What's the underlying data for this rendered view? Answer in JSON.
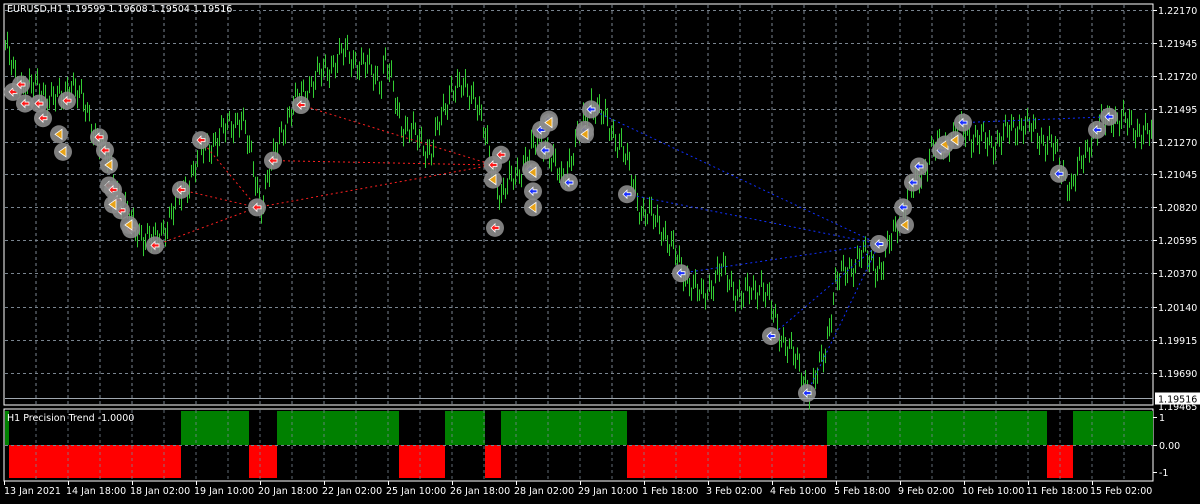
{
  "chart_data": {
    "type": "candlestick-bars",
    "symbol": "EURUSD",
    "timeframe": "H1",
    "title": "EURUSD,H1",
    "ohlc_last": {
      "open": "1.19599",
      "high": "1.19608",
      "low": "1.19504",
      "close": "1.19516"
    },
    "current_price": "1.19516",
    "ylim": [
      1.19465,
      1.222
    ],
    "price_ticks": [
      "1.22170",
      "1.21945",
      "1.21720",
      "1.21495",
      "1.21270",
      "1.21045",
      "1.20820",
      "1.20595",
      "1.20370",
      "1.20140",
      "1.19915",
      "1.19690"
    ],
    "bottom_price_label": "1.19465",
    "time_ticks": [
      "13 Jan 2021",
      "14 Jan 18:00",
      "18 Jan 02:00",
      "19 Jan 10:00",
      "20 Jan 18:00",
      "22 Jan 02:00",
      "25 Jan 10:00",
      "26 Jan 18:00",
      "28 Jan 02:00",
      "29 Jan 10:00",
      "1 Feb 18:00",
      "3 Feb 02:00",
      "4 Feb 10:00",
      "5 Feb 18:00",
      "9 Feb 02:00",
      "10 Feb 10:00",
      "11 Feb 18:00",
      "15 Feb 02:00"
    ],
    "bars_per_time_tick": 32,
    "total_bars": 575,
    "price_path_keypoints": [
      [
        0,
        1.2193
      ],
      [
        5,
        1.217
      ],
      [
        28,
        1.2155
      ],
      [
        33,
        1.217
      ],
      [
        48,
        1.2125
      ],
      [
        63,
        1.207
      ],
      [
        75,
        1.2058
      ],
      [
        88,
        1.209
      ],
      [
        98,
        1.212
      ],
      [
        118,
        1.2145
      ],
      [
        128,
        1.2085
      ],
      [
        138,
        1.2135
      ],
      [
        148,
        1.216
      ],
      [
        163,
        1.218
      ],
      [
        170,
        1.2188
      ],
      [
        188,
        1.217
      ],
      [
        190,
        1.2183
      ],
      [
        198,
        1.214
      ],
      [
        213,
        1.212
      ],
      [
        223,
        1.2165
      ],
      [
        235,
        1.216
      ],
      [
        243,
        1.211
      ],
      [
        248,
        1.209
      ],
      [
        258,
        1.211
      ],
      [
        268,
        1.213
      ],
      [
        278,
        1.21
      ],
      [
        288,
        1.2135
      ],
      [
        293,
        1.2155
      ],
      [
        308,
        1.2125
      ],
      [
        318,
        1.208
      ],
      [
        328,
        1.207
      ],
      [
        338,
        1.204
      ],
      [
        348,
        1.202
      ],
      [
        358,
        1.204
      ],
      [
        368,
        1.202
      ],
      [
        378,
        1.203
      ],
      [
        388,
        1.1995
      ],
      [
        398,
        1.197
      ],
      [
        403,
        1.1955
      ],
      [
        410,
        1.1985
      ],
      [
        415,
        1.203
      ],
      [
        428,
        1.205
      ],
      [
        438,
        1.204
      ],
      [
        448,
        1.208
      ],
      [
        463,
        1.212
      ],
      [
        478,
        1.2135
      ],
      [
        493,
        1.2125
      ],
      [
        508,
        1.214
      ],
      [
        523,
        1.2125
      ],
      [
        533,
        1.2095
      ],
      [
        543,
        1.213
      ],
      [
        553,
        1.2145
      ],
      [
        574,
        1.213
      ]
    ],
    "signals": [
      {
        "bar": 4,
        "price": 1.2161,
        "type": "sell"
      },
      {
        "bar": 8,
        "price": 1.2166,
        "type": "sell"
      },
      {
        "bar": 10,
        "price": 1.2153,
        "type": "sell"
      },
      {
        "bar": 17,
        "price": 1.2153,
        "type": "sell"
      },
      {
        "bar": 19,
        "price": 1.2143,
        "type": "sell"
      },
      {
        "bar": 31,
        "price": 1.2155,
        "type": "sell"
      },
      {
        "bar": 47,
        "price": 1.213,
        "type": "sell"
      },
      {
        "bar": 50,
        "price": 1.2121,
        "type": "sell"
      },
      {
        "bar": 52,
        "price": 1.2097,
        "type": "sell"
      },
      {
        "bar": 54,
        "price": 1.2094,
        "type": "sell"
      },
      {
        "bar": 56,
        "price": 1.2087,
        "type": "sell"
      },
      {
        "bar": 58,
        "price": 1.208,
        "type": "sell"
      },
      {
        "bar": 63,
        "price": 1.2067,
        "type": "sell"
      },
      {
        "bar": 75,
        "price": 1.2056,
        "type": "sell"
      },
      {
        "bar": 88,
        "price": 1.2094,
        "type": "sell"
      },
      {
        "bar": 98,
        "price": 1.2128,
        "type": "sell"
      },
      {
        "bar": 126,
        "price": 1.2082,
        "type": "sell"
      },
      {
        "bar": 134,
        "price": 1.2114,
        "type": "sell"
      },
      {
        "bar": 148,
        "price": 1.2152,
        "type": "sell"
      },
      {
        "bar": 244,
        "price": 1.2111,
        "type": "sell"
      },
      {
        "bar": 248,
        "price": 1.2118,
        "type": "sell"
      },
      {
        "bar": 245,
        "price": 1.2068,
        "type": "sell"
      },
      {
        "bar": 268,
        "price": 1.2135,
        "type": "buy"
      },
      {
        "bar": 272,
        "price": 1.2142,
        "type": "buy"
      },
      {
        "bar": 270,
        "price": 1.2121,
        "type": "buy"
      },
      {
        "bar": 263,
        "price": 1.2108,
        "type": "buy"
      },
      {
        "bar": 264,
        "price": 1.2093,
        "type": "buy"
      },
      {
        "bar": 282,
        "price": 1.2099,
        "type": "buy"
      },
      {
        "bar": 290,
        "price": 1.2135,
        "type": "buy"
      },
      {
        "bar": 293,
        "price": 1.2149,
        "type": "buy"
      },
      {
        "bar": 311,
        "price": 1.2091,
        "type": "buy"
      },
      {
        "bar": 338,
        "price": 1.2037,
        "type": "buy"
      },
      {
        "bar": 383,
        "price": 1.1994,
        "type": "buy"
      },
      {
        "bar": 401,
        "price": 1.1955,
        "type": "buy"
      },
      {
        "bar": 437,
        "price": 1.2057,
        "type": "buy"
      },
      {
        "bar": 449,
        "price": 1.2082,
        "type": "buy"
      },
      {
        "bar": 454,
        "price": 1.2099,
        "type": "buy"
      },
      {
        "bar": 457,
        "price": 1.211,
        "type": "buy"
      },
      {
        "bar": 468,
        "price": 1.2121,
        "type": "buy"
      },
      {
        "bar": 479,
        "price": 1.214,
        "type": "buy"
      },
      {
        "bar": 527,
        "price": 1.2105,
        "type": "buy"
      },
      {
        "bar": 546,
        "price": 1.2135,
        "type": "buy"
      },
      {
        "bar": 552,
        "price": 1.2144,
        "type": "buy"
      },
      {
        "bar": 27,
        "price": 1.2132,
        "type": "exit"
      },
      {
        "bar": 29,
        "price": 1.212,
        "type": "exit"
      },
      {
        "bar": 52,
        "price": 1.2111,
        "type": "exit"
      },
      {
        "bar": 54,
        "price": 1.2084,
        "type": "exit"
      },
      {
        "bar": 62,
        "price": 1.207,
        "type": "exit"
      },
      {
        "bar": 244,
        "price": 1.2101,
        "type": "exit"
      },
      {
        "bar": 264,
        "price": 1.2082,
        "type": "exit"
      },
      {
        "bar": 272,
        "price": 1.214,
        "type": "exit"
      },
      {
        "bar": 290,
        "price": 1.2132,
        "type": "exit"
      },
      {
        "bar": 450,
        "price": 1.207,
        "type": "exit"
      },
      {
        "bar": 470,
        "price": 1.2125,
        "type": "exit"
      },
      {
        "bar": 475,
        "price": 1.2128,
        "type": "exit"
      },
      {
        "bar": 264,
        "price": 1.2106,
        "type": "exit"
      }
    ],
    "trade_lines": [
      {
        "from": [
          75,
          1.2056
        ],
        "to": [
          126,
          1.2082
        ],
        "color": "#ff2020"
      },
      {
        "from": [
          88,
          1.2094
        ],
        "to": [
          126,
          1.2082
        ],
        "color": "#ff2020"
      },
      {
        "from": [
          98,
          1.2128
        ],
        "to": [
          126,
          1.2082
        ],
        "color": "#ff2020"
      },
      {
        "from": [
          126,
          1.2082
        ],
        "to": [
          244,
          1.2111
        ],
        "color": "#ff2020"
      },
      {
        "from": [
          134,
          1.2114
        ],
        "to": [
          244,
          1.2111
        ],
        "color": "#ff2020"
      },
      {
        "from": [
          148,
          1.2152
        ],
        "to": [
          244,
          1.2111
        ],
        "color": "#ff2020"
      },
      {
        "from": [
          293,
          1.2149
        ],
        "to": [
          437,
          1.2057
        ],
        "color": "#1030ff"
      },
      {
        "from": [
          311,
          1.2091
        ],
        "to": [
          437,
          1.2057
        ],
        "color": "#1030ff"
      },
      {
        "from": [
          338,
          1.2037
        ],
        "to": [
          437,
          1.2057
        ],
        "color": "#1030ff"
      },
      {
        "from": [
          383,
          1.1994
        ],
        "to": [
          437,
          1.2057
        ],
        "color": "#1030ff"
      },
      {
        "from": [
          401,
          1.1955
        ],
        "to": [
          437,
          1.2057
        ],
        "color": "#1030ff"
      },
      {
        "from": [
          479,
          1.214
        ],
        "to": [
          552,
          1.2144
        ],
        "color": "#1030ff"
      }
    ],
    "indicator": {
      "name": "H1 Precision Trend -1.0000",
      "scale_labels": [
        "1",
        "0.00",
        "-1"
      ],
      "segments": [
        {
          "from": 0,
          "to": 2,
          "value": 1
        },
        {
          "from": 2,
          "to": 88,
          "value": -1
        },
        {
          "from": 88,
          "to": 122,
          "value": 1
        },
        {
          "from": 122,
          "to": 136,
          "value": -1
        },
        {
          "from": 136,
          "to": 197,
          "value": 1
        },
        {
          "from": 197,
          "to": 220,
          "value": -1
        },
        {
          "from": 220,
          "to": 240,
          "value": 1
        },
        {
          "from": 240,
          "to": 248,
          "value": -1
        },
        {
          "from": 248,
          "to": 311,
          "value": 1
        },
        {
          "from": 311,
          "to": 411,
          "value": -1
        },
        {
          "from": 411,
          "to": 521,
          "value": 1
        },
        {
          "from": 521,
          "to": 534,
          "value": -1
        },
        {
          "from": 534,
          "to": 575,
          "value": 1
        }
      ]
    }
  },
  "colors": {
    "bars": "#32cd32",
    "up": "#008000",
    "down": "#ff0000",
    "sell": "#ff1a1a",
    "buy": "#1a30ff",
    "exit": "#e8a317",
    "marker_bg": "#8c8c8c",
    "grid": "#7a8590"
  },
  "header": {
    "title": "EURUSD,H1  1.19599 1.19608 1.19504 1.19516"
  },
  "indicator_header": "H1 Precision Trend -1.0000"
}
